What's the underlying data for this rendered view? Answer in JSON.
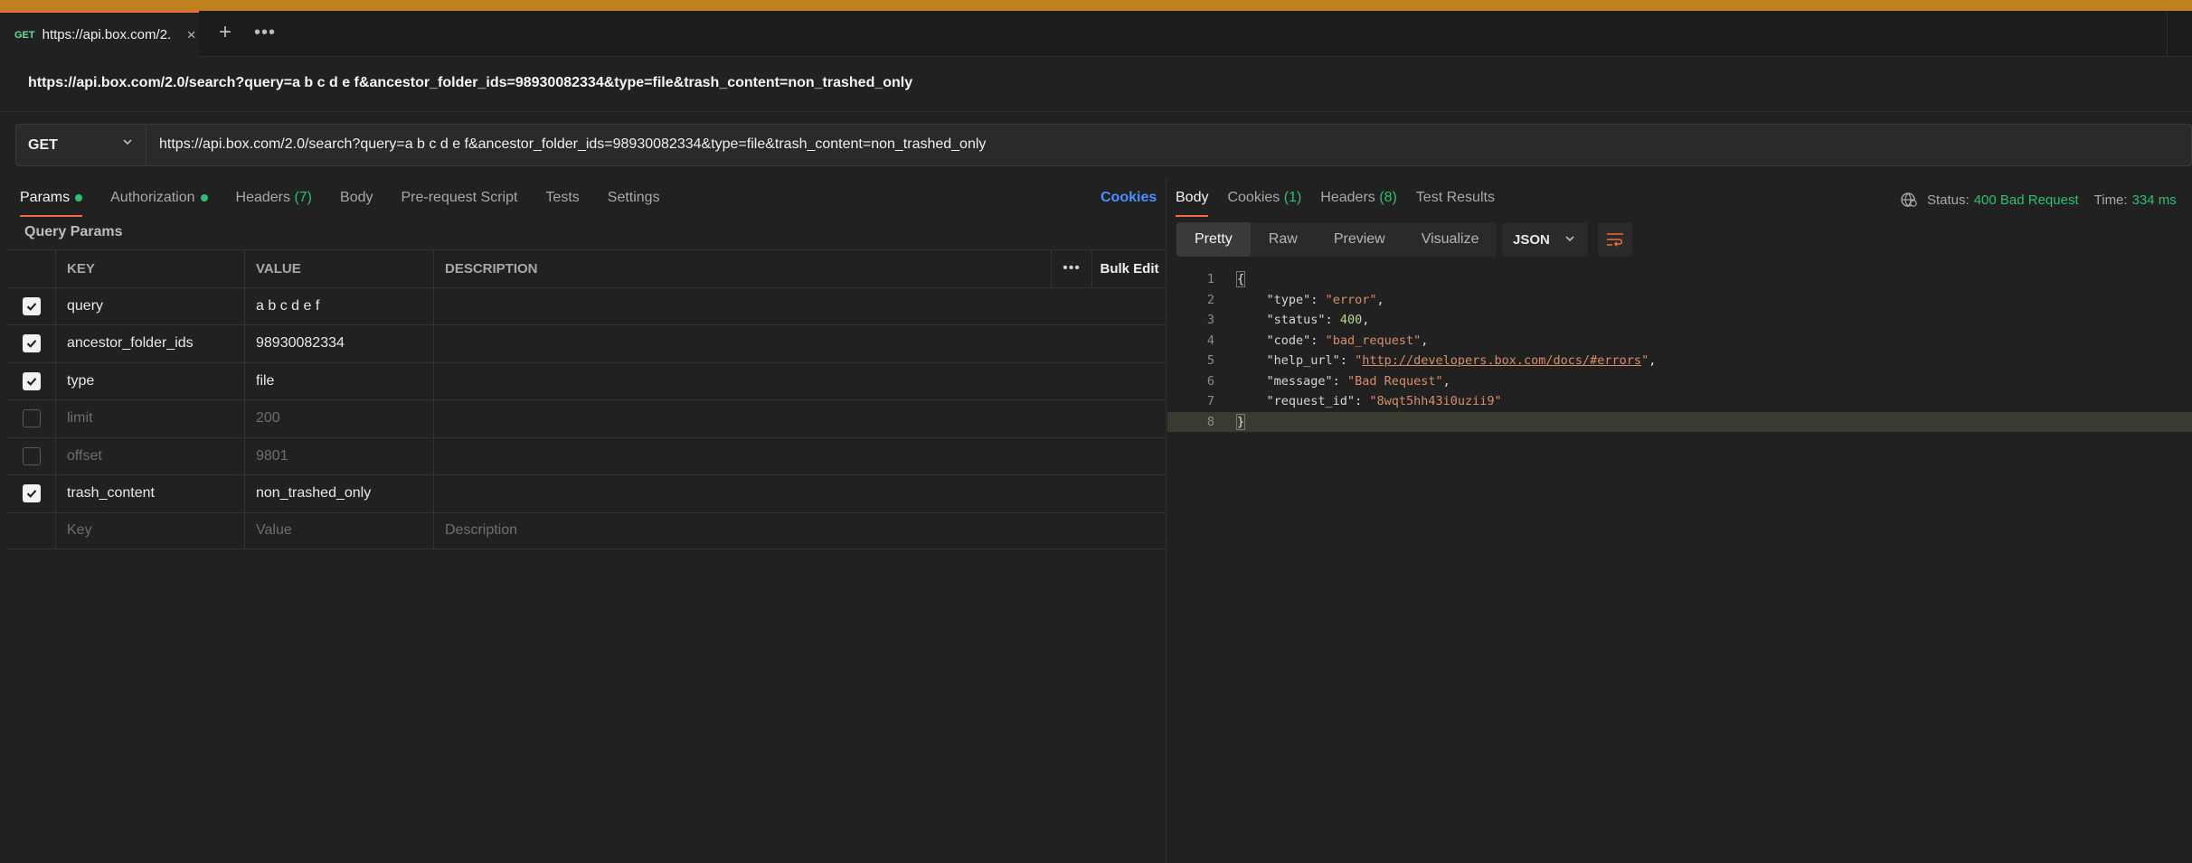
{
  "tab": {
    "method": "GET",
    "title": "https://api.box.com/2."
  },
  "request": {
    "name": "https://api.box.com/2.0/search?query=a b c d e f&ancestor_folder_ids=98930082334&type=file&trash_content=non_trashed_only",
    "method": "GET",
    "url": "https://api.box.com/2.0/search?query=a b c d e f&ancestor_folder_ids=98930082334&type=file&trash_content=non_trashed_only"
  },
  "request_tabs": {
    "params": "Params",
    "authorization": "Authorization",
    "headers": "Headers",
    "headers_count": "(7)",
    "body": "Body",
    "prerequest": "Pre-request Script",
    "tests": "Tests",
    "settings": "Settings",
    "cookies": "Cookies"
  },
  "query_params": {
    "title": "Query Params",
    "columns": {
      "key": "KEY",
      "value": "VALUE",
      "description": "DESCRIPTION",
      "more": "•••",
      "bulk_edit": "Bulk Edit"
    },
    "rows": [
      {
        "checked": true,
        "key": "query",
        "value": "a b c d e f",
        "description": ""
      },
      {
        "checked": true,
        "key": "ancestor_folder_ids",
        "value": "98930082334",
        "description": ""
      },
      {
        "checked": true,
        "key": "type",
        "value": "file",
        "description": ""
      },
      {
        "checked": false,
        "key": "limit",
        "value": "200",
        "description": ""
      },
      {
        "checked": false,
        "key": "offset",
        "value": "9801",
        "description": ""
      },
      {
        "checked": true,
        "key": "trash_content",
        "value": "non_trashed_only",
        "description": ""
      }
    ],
    "new_row": {
      "key": "Key",
      "value": "Value",
      "description": "Description"
    }
  },
  "response_tabs": {
    "body": "Body",
    "cookies": "Cookies",
    "cookies_count": "(1)",
    "headers": "Headers",
    "headers_count": "(8)",
    "test_results": "Test Results"
  },
  "response_status": {
    "status_label": "Status:",
    "status_value": "400 Bad Request",
    "time_label": "Time:",
    "time_value": "334 ms"
  },
  "response_view": {
    "modes": [
      "Pretty",
      "Raw",
      "Preview",
      "Visualize"
    ],
    "active_mode": "Pretty",
    "format": "JSON"
  },
  "response_body": {
    "lines": [
      {
        "n": "1",
        "open": "{"
      },
      {
        "n": "2",
        "key": "\"type\"",
        "value": "\"error\"",
        "kind": "str",
        "comma": ","
      },
      {
        "n": "3",
        "key": "\"status\"",
        "value": "400",
        "kind": "num",
        "comma": ","
      },
      {
        "n": "4",
        "key": "\"code\"",
        "value": "\"bad_request\"",
        "kind": "str",
        "comma": ","
      },
      {
        "n": "5",
        "key": "\"help_url\"",
        "value_q": "\"",
        "value_link": "http://developers.box.com/docs/#errors",
        "kind": "link",
        "comma": ","
      },
      {
        "n": "6",
        "key": "\"message\"",
        "value": "\"Bad Request\"",
        "kind": "str",
        "comma": ","
      },
      {
        "n": "7",
        "key": "\"request_id\"",
        "value": "\"8wqt5hh43i0uzii9\"",
        "kind": "str",
        "comma": ""
      },
      {
        "n": "8",
        "close": "}"
      }
    ]
  },
  "colors": {
    "accent": "#f26b3a",
    "status_ok_green": "#2fbf71",
    "link_blue": "#4c8fff",
    "banner": "#c0801f"
  }
}
